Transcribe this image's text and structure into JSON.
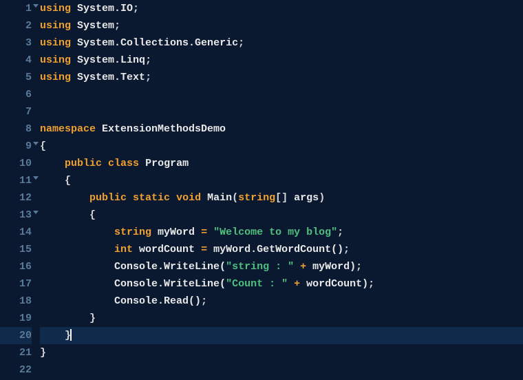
{
  "gutter": {
    "lines": [
      "1",
      "2",
      "3",
      "4",
      "5",
      "6",
      "7",
      "8",
      "9",
      "10",
      "11",
      "12",
      "13",
      "14",
      "15",
      "16",
      "17",
      "18",
      "19",
      "20",
      "21",
      "22"
    ],
    "foldMarkers": [
      1,
      9,
      11,
      13
    ]
  },
  "code": {
    "l1": {
      "kw": "using",
      "ns": "System.IO",
      "sc": ";"
    },
    "l2": {
      "kw": "using",
      "ns": "System",
      "sc": ";"
    },
    "l3": {
      "kw": "using",
      "ns": "System.Collections.Generic",
      "sc": ";"
    },
    "l4": {
      "kw": "using",
      "ns": "System.Linq",
      "sc": ";"
    },
    "l5": {
      "kw": "using",
      "ns": "System.Text",
      "sc": ";"
    },
    "l8": {
      "kw": "namespace",
      "ns": "ExtensionMethodsDemo"
    },
    "l9": {
      "br": "{"
    },
    "l10": {
      "kw1": "public",
      "kw2": "class",
      "cls": "Program"
    },
    "l11": {
      "br": "{"
    },
    "l12": {
      "kw1": "public",
      "kw2": "static",
      "kw3": "void",
      "mth": "Main",
      "lp": "(",
      "type": "string",
      "arr": "[]",
      "arg": " args",
      "rp": ")"
    },
    "l13": {
      "br": "{"
    },
    "l14": {
      "type": "string",
      "var": " myWord ",
      "op": "=",
      "str": " \"Welcome to my blog\"",
      "sc": ";"
    },
    "l15": {
      "type": "int",
      "var": " wordCount ",
      "op": "=",
      "expr": " myWord.GetWordCount()",
      "sc": ";"
    },
    "l16": {
      "call": "Console.WriteLine(",
      "str": "\"string : \"",
      "op": " + ",
      "var": "myWord)",
      "sc": ";"
    },
    "l17": {
      "call": "Console.WriteLine(",
      "str": "\"Count : \"",
      "op": " + ",
      "var": "wordCount)",
      "sc": ";"
    },
    "l18": {
      "call": "Console.Read()",
      "sc": ";"
    },
    "l19": {
      "br": "}"
    },
    "l20": {
      "br": "}"
    },
    "l21": {
      "br": "}"
    }
  },
  "highlightLine": 20
}
